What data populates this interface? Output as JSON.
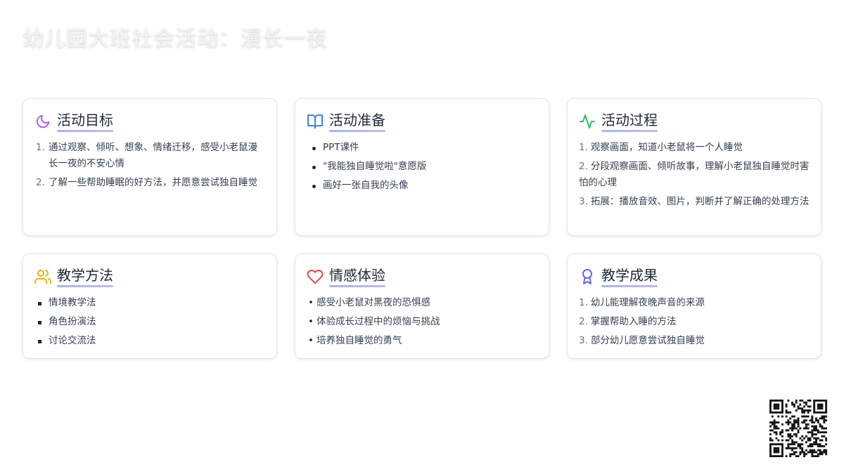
{
  "title": "幼儿园大班社会活动：漫长一夜",
  "colors": {
    "moon": "#a855f7",
    "book": "#3b82f6",
    "pulse": "#22c55e",
    "users": "#eab308",
    "heart": "#ef4444",
    "award": "#6366f1"
  },
  "cards": {
    "goals": {
      "icon": "moon-icon",
      "title": "活动目标",
      "items": [
        "通过观察、倾听、想象、情绪迁移，感受小老鼠漫长一夜的不安心情",
        "了解一些帮助睡眠的好方法，并愿意尝试独自睡觉"
      ]
    },
    "prep": {
      "icon": "book-open-icon",
      "title": "活动准备",
      "items": [
        "PPT课件",
        "\"我能独自睡觉啦\"意愿版",
        "画好一张自我的头像"
      ]
    },
    "process": {
      "icon": "activity-icon",
      "title": "活动过程",
      "items": [
        "观察画面，知道小老鼠将一个人睡觉",
        "分段观察画面、倾听故事，理解小老鼠独自睡觉时害怕的心理",
        "拓展：播放音效、图片，判断并了解正确的处理方法"
      ]
    },
    "methods": {
      "icon": "users-icon",
      "title": "教学方法",
      "items": [
        "情境教学法",
        "角色扮演法",
        "讨论交流法"
      ]
    },
    "emotion": {
      "icon": "heart-icon",
      "title": "情感体验",
      "items": [
        "感受小老鼠对黑夜的恐惧感",
        "体验成长过程中的烦恼与挑战",
        "培养独自睡觉的勇气"
      ]
    },
    "results": {
      "icon": "award-icon",
      "title": "教学成果",
      "items": [
        "幼儿能理解夜晚声音的来源",
        "掌握帮助入睡的方法",
        "部分幼儿愿意尝试独自睡觉"
      ]
    }
  },
  "numbers": [
    "1.",
    "2.",
    "3."
  ]
}
